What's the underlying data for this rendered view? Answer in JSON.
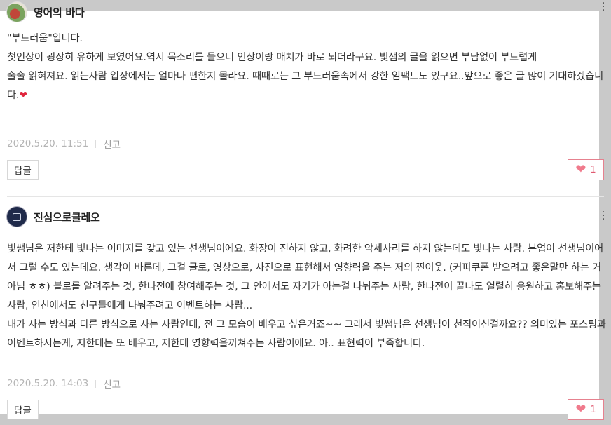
{
  "comments": [
    {
      "author": "영어의 바다",
      "body": "\"부드러움\"입니다.\n첫인상이 굉장히 유하게 보였어요.역시 목소리를 들으니 인상이랑 매치가 바로 되더라구요. 빛샘의 글을 읽으면 부담없이 부드럽게\n술술 읽혀져요. 읽는사람 입장에서는 얼마나 편한지 몰라요. 때때로는 그 부드러움속에서 강한 임팩트도 있구요..앞으로 좋은 글 많이 기대하겠습니다.",
      "emoji": "❤",
      "date": "2020.5.20. 11:51",
      "report": "신고",
      "reply": "답글",
      "likes": "1",
      "avatar_icon": "profile-photo-icon"
    },
    {
      "author": "진심으로클레오",
      "body": "빛쌤님은 저한테 빛나는 이미지를 갖고 있는 선생님이에요. 화장이 진하지 않고, 화려한 악세사리를 하지 않는데도 빛나는 사람. 본업이 선생님이어서 그럴 수도 있는데요. 생각이 바른데, 그걸 글로, 영상으로, 사진으로 표현해서 영향력을 주는 저의 찐이웃. (커피쿠폰 받으려고 좋은말만 하는 거 아님 ㅎㅎ) 블로를 알려주는 것, 한나전에 참여해주는 것, 그 안에서도 자기가 아는걸 나눠주는 사람, 한나전이 끝나도 열렬히 응원하고 홍보해주는 사람, 인친에서도 친구들에게 나눠주려고 이벤트하는 사람...\n내가 사는 방식과 다른 방식으로 사는 사람인데, 전 그 모습이 배우고 싶은거죠~~ 그래서 빛쌤님은 선생님이 천직이신걸까요?? 의미있는 포스팅과 이벤트하시는게, 저한테는 또 배우고, 저한테 영향력을끼쳐주는 사람이에요. 아.. 표현력이 부족합니다.",
      "date": "2020.5.20. 14:03",
      "report": "신고",
      "reply": "답글",
      "likes": "1",
      "avatar_icon": "profile-photo-icon"
    }
  ],
  "icons": {
    "more": "more-vertical-icon",
    "like": "heart-icon"
  },
  "colors": {
    "like_border": "#e6818f",
    "like_heart": "#f07a8c",
    "meta_text": "#b4b4b4"
  }
}
